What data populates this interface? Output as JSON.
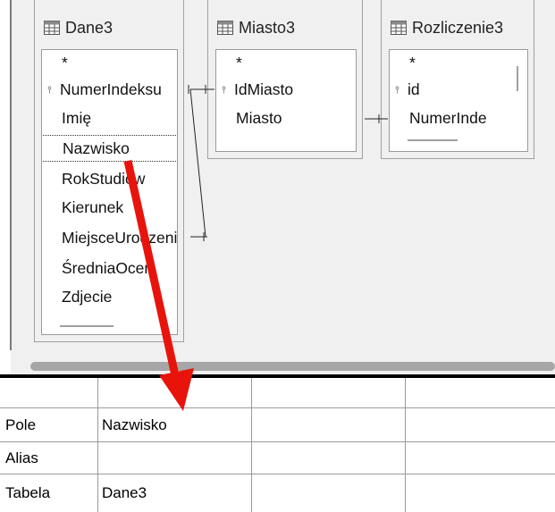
{
  "tables": [
    {
      "title": "Dane3",
      "fields": [
        "*",
        "NumerIndeksu",
        "Imię",
        "Nazwisko",
        "RokStudiów",
        "Kierunek",
        "MiejsceUrodzenia",
        "ŚredniaOcen",
        "Zdjecie"
      ],
      "selected": "Nazwisko",
      "key_field": "NumerIndeksu"
    },
    {
      "title": "Miasto3",
      "fields": [
        "*",
        "IdMiasto",
        "Miasto"
      ],
      "key_field": "IdMiasto"
    },
    {
      "title": "Rozliczenie3",
      "fields": [
        "*",
        "id",
        "NumerInde"
      ],
      "key_field": "id"
    }
  ],
  "grid": {
    "row_labels": [
      "Pole",
      "Alias",
      "Tabela"
    ],
    "values": {
      "pole": "Nazwisko",
      "alias": "",
      "tabela": "Dane3"
    }
  },
  "arrow": {
    "color": "#e8140c"
  }
}
